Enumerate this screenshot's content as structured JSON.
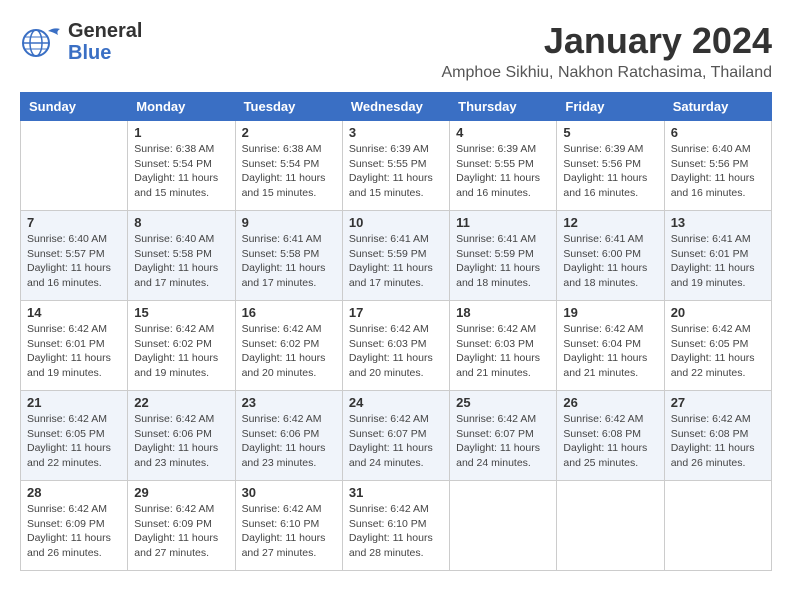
{
  "header": {
    "logo_line1": "General",
    "logo_line2": "Blue",
    "month": "January 2024",
    "location": "Amphoe Sikhiu, Nakhon Ratchasima, Thailand"
  },
  "weekdays": [
    "Sunday",
    "Monday",
    "Tuesday",
    "Wednesday",
    "Thursday",
    "Friday",
    "Saturday"
  ],
  "weeks": [
    [
      null,
      {
        "day": "1",
        "sunrise": "6:38 AM",
        "sunset": "5:54 PM",
        "daylight": "11 hours and 15 minutes."
      },
      {
        "day": "2",
        "sunrise": "6:38 AM",
        "sunset": "5:54 PM",
        "daylight": "11 hours and 15 minutes."
      },
      {
        "day": "3",
        "sunrise": "6:39 AM",
        "sunset": "5:55 PM",
        "daylight": "11 hours and 15 minutes."
      },
      {
        "day": "4",
        "sunrise": "6:39 AM",
        "sunset": "5:55 PM",
        "daylight": "11 hours and 16 minutes."
      },
      {
        "day": "5",
        "sunrise": "6:39 AM",
        "sunset": "5:56 PM",
        "daylight": "11 hours and 16 minutes."
      },
      {
        "day": "6",
        "sunrise": "6:40 AM",
        "sunset": "5:56 PM",
        "daylight": "11 hours and 16 minutes."
      }
    ],
    [
      {
        "day": "7",
        "sunrise": "6:40 AM",
        "sunset": "5:57 PM",
        "daylight": "11 hours and 16 minutes."
      },
      {
        "day": "8",
        "sunrise": "6:40 AM",
        "sunset": "5:58 PM",
        "daylight": "11 hours and 17 minutes."
      },
      {
        "day": "9",
        "sunrise": "6:41 AM",
        "sunset": "5:58 PM",
        "daylight": "11 hours and 17 minutes."
      },
      {
        "day": "10",
        "sunrise": "6:41 AM",
        "sunset": "5:59 PM",
        "daylight": "11 hours and 17 minutes."
      },
      {
        "day": "11",
        "sunrise": "6:41 AM",
        "sunset": "5:59 PM",
        "daylight": "11 hours and 18 minutes."
      },
      {
        "day": "12",
        "sunrise": "6:41 AM",
        "sunset": "6:00 PM",
        "daylight": "11 hours and 18 minutes."
      },
      {
        "day": "13",
        "sunrise": "6:41 AM",
        "sunset": "6:01 PM",
        "daylight": "11 hours and 19 minutes."
      }
    ],
    [
      {
        "day": "14",
        "sunrise": "6:42 AM",
        "sunset": "6:01 PM",
        "daylight": "11 hours and 19 minutes."
      },
      {
        "day": "15",
        "sunrise": "6:42 AM",
        "sunset": "6:02 PM",
        "daylight": "11 hours and 19 minutes."
      },
      {
        "day": "16",
        "sunrise": "6:42 AM",
        "sunset": "6:02 PM",
        "daylight": "11 hours and 20 minutes."
      },
      {
        "day": "17",
        "sunrise": "6:42 AM",
        "sunset": "6:03 PM",
        "daylight": "11 hours and 20 minutes."
      },
      {
        "day": "18",
        "sunrise": "6:42 AM",
        "sunset": "6:03 PM",
        "daylight": "11 hours and 21 minutes."
      },
      {
        "day": "19",
        "sunrise": "6:42 AM",
        "sunset": "6:04 PM",
        "daylight": "11 hours and 21 minutes."
      },
      {
        "day": "20",
        "sunrise": "6:42 AM",
        "sunset": "6:05 PM",
        "daylight": "11 hours and 22 minutes."
      }
    ],
    [
      {
        "day": "21",
        "sunrise": "6:42 AM",
        "sunset": "6:05 PM",
        "daylight": "11 hours and 22 minutes."
      },
      {
        "day": "22",
        "sunrise": "6:42 AM",
        "sunset": "6:06 PM",
        "daylight": "11 hours and 23 minutes."
      },
      {
        "day": "23",
        "sunrise": "6:42 AM",
        "sunset": "6:06 PM",
        "daylight": "11 hours and 23 minutes."
      },
      {
        "day": "24",
        "sunrise": "6:42 AM",
        "sunset": "6:07 PM",
        "daylight": "11 hours and 24 minutes."
      },
      {
        "day": "25",
        "sunrise": "6:42 AM",
        "sunset": "6:07 PM",
        "daylight": "11 hours and 24 minutes."
      },
      {
        "day": "26",
        "sunrise": "6:42 AM",
        "sunset": "6:08 PM",
        "daylight": "11 hours and 25 minutes."
      },
      {
        "day": "27",
        "sunrise": "6:42 AM",
        "sunset": "6:08 PM",
        "daylight": "11 hours and 26 minutes."
      }
    ],
    [
      {
        "day": "28",
        "sunrise": "6:42 AM",
        "sunset": "6:09 PM",
        "daylight": "11 hours and 26 minutes."
      },
      {
        "day": "29",
        "sunrise": "6:42 AM",
        "sunset": "6:09 PM",
        "daylight": "11 hours and 27 minutes."
      },
      {
        "day": "30",
        "sunrise": "6:42 AM",
        "sunset": "6:10 PM",
        "daylight": "11 hours and 27 minutes."
      },
      {
        "day": "31",
        "sunrise": "6:42 AM",
        "sunset": "6:10 PM",
        "daylight": "11 hours and 28 minutes."
      },
      null,
      null,
      null
    ]
  ],
  "labels": {
    "sunrise": "Sunrise:",
    "sunset": "Sunset:",
    "daylight": "Daylight:"
  }
}
